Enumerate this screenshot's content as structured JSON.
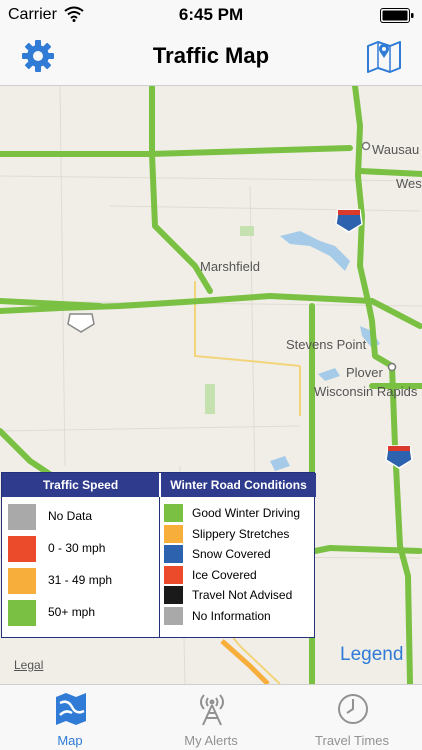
{
  "status_bar": {
    "carrier": "Carrier",
    "time": "6:45 PM"
  },
  "nav": {
    "title": "Traffic Map",
    "left_icon": "gear-icon",
    "right_icon": "map-icon"
  },
  "map": {
    "places": [
      {
        "key": "wausau",
        "label": "Wausau"
      },
      {
        "key": "weston",
        "label": "Wes"
      },
      {
        "key": "marshfield",
        "label": "Marshfield"
      },
      {
        "key": "stevens_point",
        "label": "Stevens Point"
      },
      {
        "key": "plover",
        "label": "Plover"
      },
      {
        "key": "wisconsin_rapids",
        "label": "Wisconsin Rapids"
      }
    ],
    "legal": "Legal",
    "legend_link": "Legend"
  },
  "legend": {
    "speed_title": "Traffic Speed",
    "conditions_title": "Winter Road Conditions",
    "speed_items": [
      {
        "label": "No Data",
        "color": "#a9a9a9"
      },
      {
        "label": "0 - 30 mph",
        "color": "#ec4b2b"
      },
      {
        "label": "31 - 49 mph",
        "color": "#f7ae3a"
      },
      {
        "label": "50+ mph",
        "color": "#7ac143"
      }
    ],
    "condition_items": [
      {
        "label": "Good Winter Driving",
        "color": "#7ac143"
      },
      {
        "label": "Slippery Stretches",
        "color": "#f7ae3a"
      },
      {
        "label": "Snow Covered",
        "color": "#2d62ae"
      },
      {
        "label": "Ice Covered",
        "color": "#ec4b2b"
      },
      {
        "label": "Travel Not Advised",
        "color": "#1a1a1a"
      },
      {
        "label": "No Information",
        "color": "#a9a9a9"
      }
    ]
  },
  "tabs": [
    {
      "label": "Map",
      "icon": "map-icon",
      "active": true
    },
    {
      "label": "My Alerts",
      "icon": "radio-tower-icon",
      "active": false
    },
    {
      "label": "Travel Times",
      "icon": "clock-icon",
      "active": false
    }
  ],
  "colors": {
    "accent": "#2f7bd6",
    "road_good": "#7ac143",
    "legend_header": "#2f3b8d"
  }
}
